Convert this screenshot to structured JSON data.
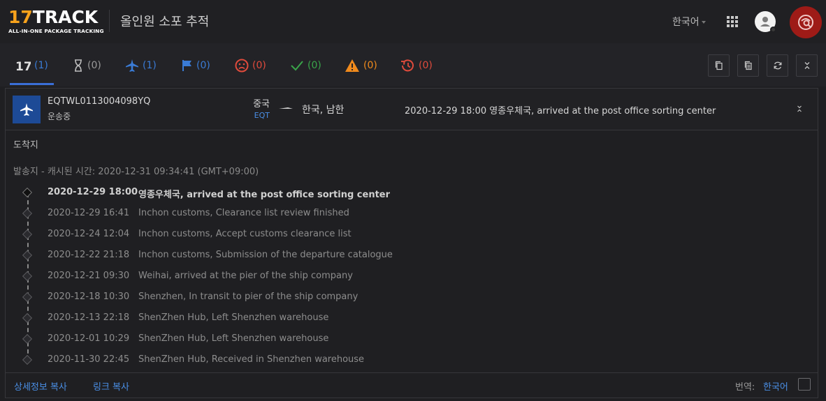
{
  "header": {
    "logo_main": "17TRACK",
    "logo_sub": "ALL-IN-ONE PACKAGE TRACKING",
    "title": "올인원 소포 추적",
    "language": "한국어"
  },
  "tabs": [
    {
      "id": "all",
      "count": "(1)",
      "color": "#3a7bd5"
    },
    {
      "id": "not-found",
      "count": "(0)",
      "color": "#9a9a9a"
    },
    {
      "id": "in-transit",
      "count": "(1)",
      "color": "#3a7bd5"
    },
    {
      "id": "pick-up",
      "count": "(0)",
      "color": "#3a7bd5"
    },
    {
      "id": "undelivered",
      "count": "(0)",
      "color": "#e04b3c"
    },
    {
      "id": "delivered",
      "count": "(0)",
      "color": "#3aa54a"
    },
    {
      "id": "alert",
      "count": "(0)",
      "color": "#f08a1c"
    },
    {
      "id": "expired",
      "count": "(0)",
      "color": "#e04b3c"
    }
  ],
  "shipment": {
    "tracking_number": "EQTWL0113004098YQ",
    "status": "운송중",
    "origin_country": "중국",
    "carrier": "EQT",
    "destination_country": "한국, 남한",
    "latest_event": "2020-12-29 18:00  영종우체국, arrived at the post office sorting center"
  },
  "labels": {
    "destination": "도착지",
    "origin": "발송지",
    "cached_time": " - 캐시된 시간: 2020-12-31 09:34:41 (GMT+09:00)"
  },
  "events": [
    {
      "time": "2020-12-29 18:00",
      "desc": "영종우체국, arrived at the post office sorting center"
    },
    {
      "time": "2020-12-29 16:41",
      "desc": "Inchon customs, Clearance list review finished"
    },
    {
      "time": "2020-12-24 12:04",
      "desc": "Inchon customs, Accept customs clearance list"
    },
    {
      "time": "2020-12-22 21:18",
      "desc": "Inchon customs, Submission of the departure catalogue"
    },
    {
      "time": "2020-12-21 09:30",
      "desc": "Weihai, arrived at the pier of the ship company"
    },
    {
      "time": "2020-12-18 10:30",
      "desc": "Shenzhen, In transit to pier of the ship company"
    },
    {
      "time": "2020-12-13 22:18",
      "desc": "ShenZhen Hub, Left Shenzhen warehouse"
    },
    {
      "time": "2020-12-01 10:29",
      "desc": "ShenZhen Hub, Left Shenzhen warehouse"
    },
    {
      "time": "2020-11-30 22:45",
      "desc": "ShenZhen Hub, Received in Shenzhen warehouse"
    }
  ],
  "footer": {
    "copy_details": "상세정보 복사",
    "copy_link": "링크 복사",
    "translate_label": "번역:",
    "translate_lang": "한국어"
  }
}
